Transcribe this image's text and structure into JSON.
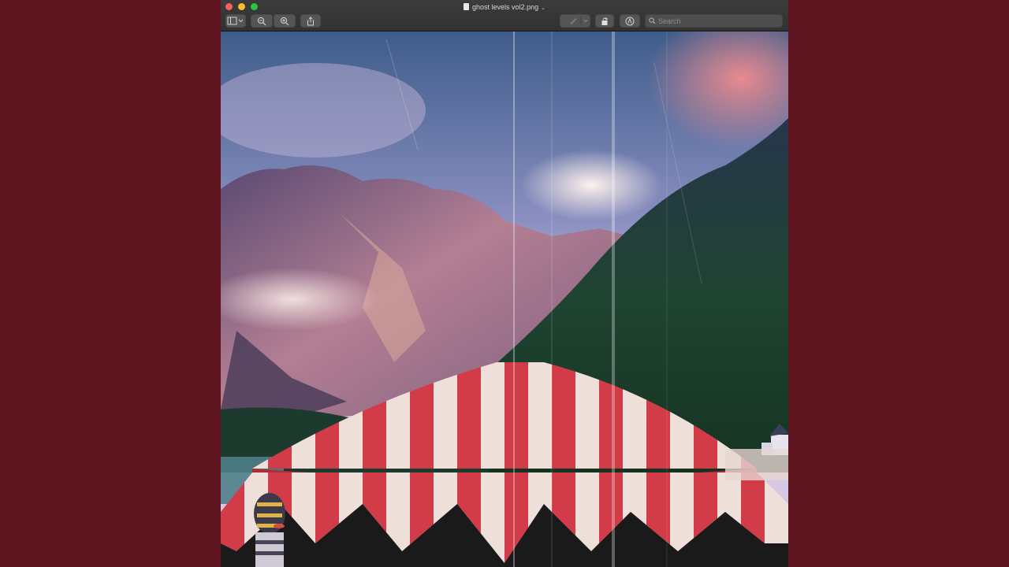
{
  "window": {
    "title": "ghost levels vol2.png",
    "title_caret": "⌄"
  },
  "toolbar": {
    "sidebar_icon": "sidebar-toggle-icon",
    "zoom_out_icon": "zoom-out-icon",
    "zoom_in_icon": "zoom-in-icon",
    "share_icon": "share-icon",
    "markup_pen_icon": "pen-icon",
    "rotate_icon": "rotate-icon",
    "markup_icon": "markup-icon",
    "search_placeholder": "Search"
  },
  "image": {
    "description_icon": "photo-artwork",
    "colors": {
      "background": "#5e1520",
      "tent_red": "#d23c48",
      "tent_white": "#eee0d8",
      "forest": "#1f3a2a",
      "sky_top": "#3e5c8a"
    }
  }
}
